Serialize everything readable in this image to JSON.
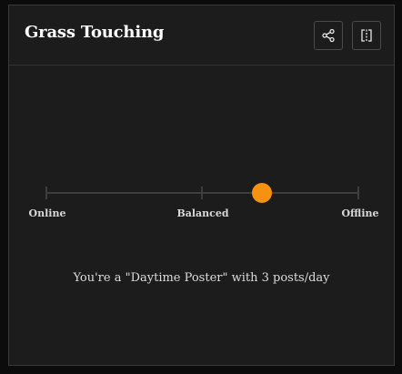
{
  "card": {
    "title": "Grass Touching"
  },
  "actions": {
    "share_icon": "share-icon",
    "split_icon": "split-view-icon"
  },
  "slider": {
    "labels": [
      "Online",
      "Balanced",
      "Offline"
    ],
    "value_fraction": 0.69,
    "knob_color": "#f5920f",
    "track_color": "#3e3e3e"
  },
  "summary": {
    "text": "You're a \"Daytime Poster\" with 3 posts/day"
  }
}
